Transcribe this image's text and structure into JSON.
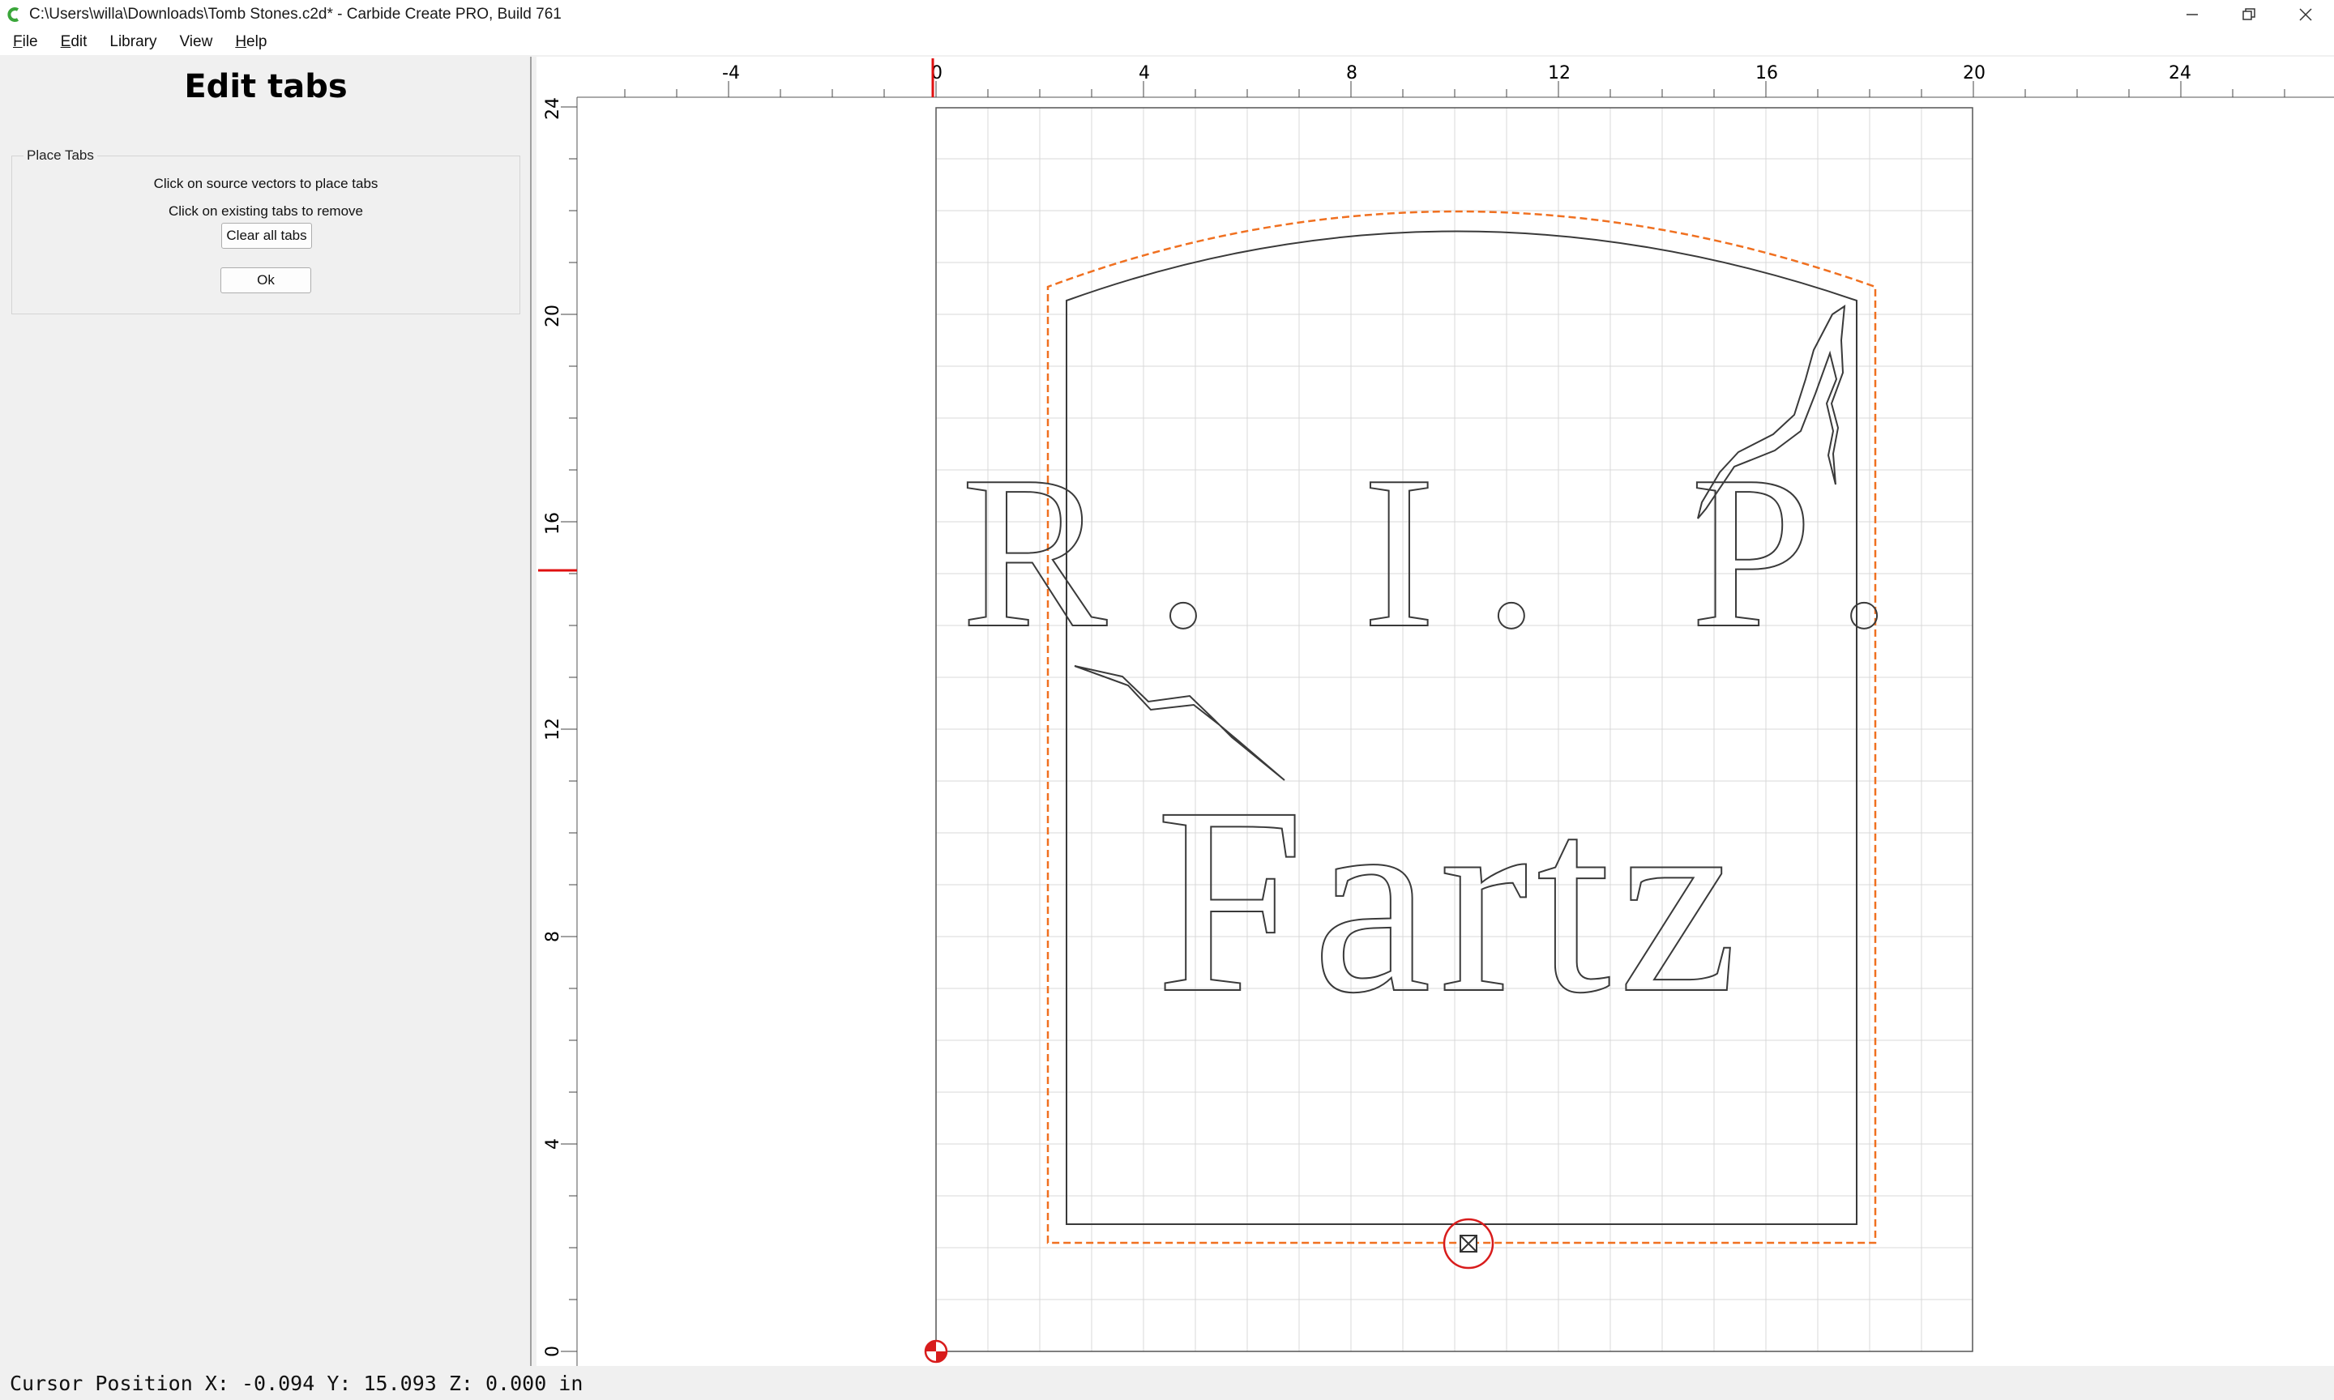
{
  "window": {
    "title": "C:\\Users\\willa\\Downloads\\Tomb Stones.c2d* - Carbide Create PRO, Build 761",
    "controls": [
      "minimize",
      "restore",
      "close"
    ]
  },
  "menu": {
    "items": [
      {
        "label": "File",
        "mnemonic": "F",
        "rest": "ile"
      },
      {
        "label": "Edit",
        "mnemonic": "E",
        "rest": "dit"
      },
      {
        "label": "Library",
        "mnemonic": "",
        "rest": "Library"
      },
      {
        "label": "View",
        "mnemonic": "",
        "rest": "View"
      },
      {
        "label": "Help",
        "mnemonic": "H",
        "rest": "elp"
      }
    ]
  },
  "panel": {
    "heading": "Edit tabs",
    "group_title": "Place Tabs",
    "instruction_place": "Click on source vectors to place tabs",
    "instruction_remove": "Click on existing tabs to remove",
    "clear_button": "Clear all tabs",
    "ok_button": "Ok"
  },
  "rulers": {
    "horizontal_labels": [
      "-4",
      "0",
      "4",
      "8",
      "12",
      "16",
      "20",
      "24"
    ],
    "vertical_labels": [
      "24",
      "20",
      "16",
      "12",
      "8",
      "4",
      "0"
    ],
    "units": "in"
  },
  "design": {
    "line1": "R. I. P.",
    "line2": "Fartz",
    "stock_width": 20,
    "stock_height": 24,
    "toolpath_color": "#f07020",
    "outline_color": "#3a3a3a",
    "tab_marker_color": "#d81c1c"
  },
  "status": {
    "cursor_text": "Cursor Position X: -0.094 Y: 15.093 Z: 0.000 in"
  }
}
